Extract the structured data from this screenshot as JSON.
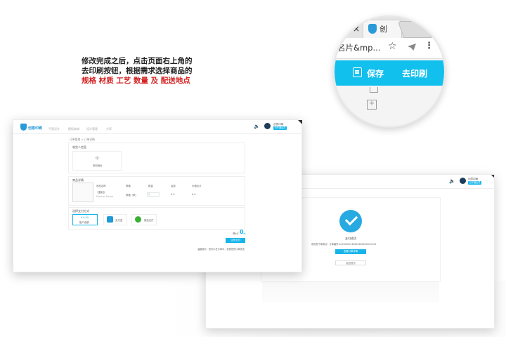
{
  "instruction": {
    "line1": "修改完成之后，点击页面右上角的",
    "line2": "去印刷按钮，根据需求选择商品的",
    "line3": "规格 材质 工艺 数量 及 配送地点"
  },
  "magnifier": {
    "tab_close": "×",
    "tab_title": "创",
    "url_fragment": "名片&mp...",
    "save_label": "保存",
    "print_label": "去印刷",
    "plus_glyph": "+"
  },
  "main_page": {
    "logo_text": "创意印刷",
    "nav": [
      "平面设计",
      "模板商城",
      "设计管理",
      "分享"
    ],
    "user_name": "创意印刷",
    "user_badge": "已开通会员",
    "breadcrumb": "订单管理 > 订单详情",
    "consignee_title": "收货人信息",
    "add_address": "添加地址",
    "product_title": "商品详情",
    "columns": [
      "商品名称",
      "规格",
      "数量",
      "运费",
      "价格合计"
    ],
    "product_name": "【名片】",
    "product_sub": "Product Name",
    "spec": "规格（默）",
    "qty": "1",
    "freight": "¥ 0",
    "price": "¥ 0",
    "payment_title": "选择支付方式",
    "pay_options": [
      "账户余额",
      "支付宝",
      "微信支付"
    ],
    "pay_balance_amount": "¥ 0.00",
    "total_label": "合计：",
    "total_value": "0",
    "total_unit": "元",
    "submit_label": "立即支付",
    "note": "温馨提示：您可以在订单中，查看您的订单状态"
  },
  "success_page": {
    "user_name": "创意印刷",
    "user_badge": "已开通会员",
    "title": "支付成功",
    "detail": "恭喜您下单成功！订单编号:20190620180603600000001234",
    "view_order": "查看订单详情",
    "back_home": "返回首页"
  }
}
